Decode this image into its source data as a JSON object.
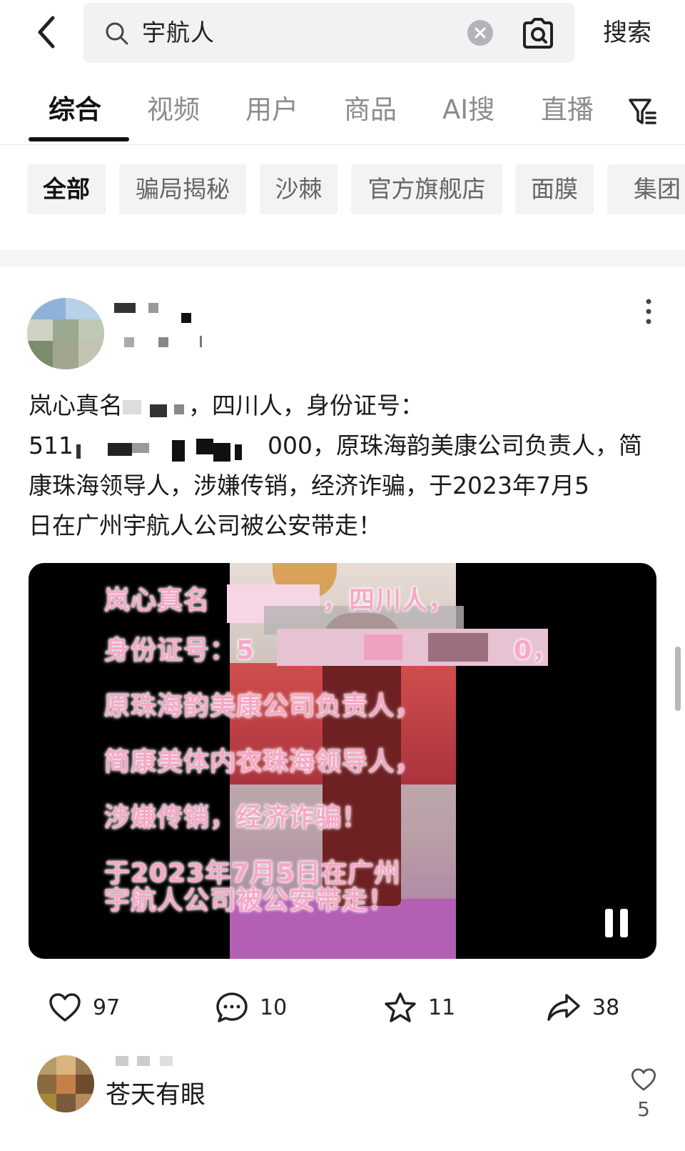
{
  "search": {
    "query": "宇航人",
    "action_label": "搜索"
  },
  "tabs": [
    {
      "label": "综合",
      "active": true
    },
    {
      "label": "视频",
      "active": false
    },
    {
      "label": "用户",
      "active": false
    },
    {
      "label": "商品",
      "active": false
    },
    {
      "label": "AI搜",
      "active": false
    },
    {
      "label": "直播",
      "active": false
    }
  ],
  "chips": [
    {
      "label": "全部",
      "active": true
    },
    {
      "label": "骗局揭秘",
      "active": false
    },
    {
      "label": "沙棘",
      "active": false
    },
    {
      "label": "官方旗舰店",
      "active": false
    },
    {
      "label": "面膜",
      "active": false
    },
    {
      "label": "集团",
      "active": false
    }
  ],
  "post": {
    "text_lines": [
      {
        "before": "岚心真名",
        "after": "，四川人，身份证号："
      },
      {
        "before": "511",
        "after": "000，原珠海韵美康公司负责人，简"
      },
      {
        "before": "康珠海领导人，涉嫌传销，经济诈骗，于2023年7月5",
        "after": ""
      },
      {
        "before": "日在广州宇航人公司被公安带走！",
        "after": ""
      }
    ],
    "video_captions": [
      "岚心真名",
      "，四川人，",
      "身份证号：5",
      "0，",
      "原珠海韵美康公司负责人，",
      "简康美体内衣珠海领导人，",
      "涉嫌传销，经济诈骗！",
      "于2023年7月5日在广州",
      "宇航人公司被公安带走！"
    ],
    "stats": {
      "likes": "97",
      "comments": "10",
      "favorites": "11",
      "shares": "38"
    }
  },
  "comment": {
    "text": "苍天有眼",
    "likes": "5"
  },
  "colors": {
    "caption_pink": "#f7a8c6",
    "tab_active": "#111111",
    "tab_inactive": "#8c8c8c",
    "chip_bg": "#f3f3f5"
  }
}
